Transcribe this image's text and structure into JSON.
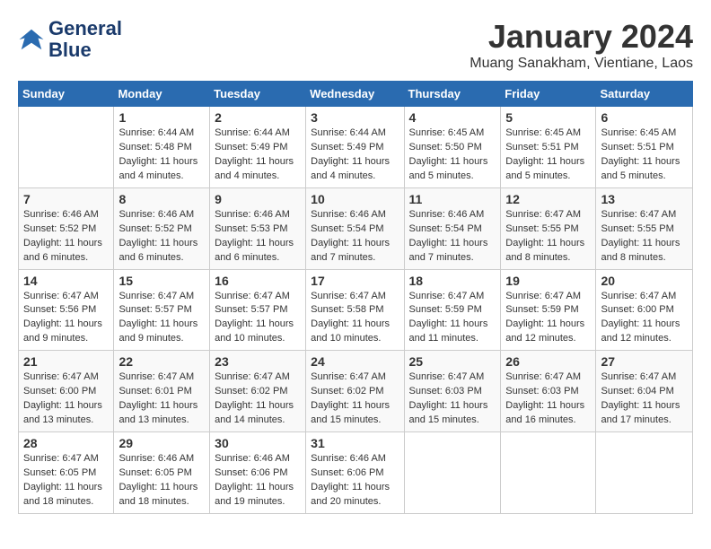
{
  "header": {
    "logo_line1": "General",
    "logo_line2": "Blue",
    "month_title": "January 2024",
    "location": "Muang Sanakham, Vientiane, Laos"
  },
  "days_of_week": [
    "Sunday",
    "Monday",
    "Tuesday",
    "Wednesday",
    "Thursday",
    "Friday",
    "Saturday"
  ],
  "weeks": [
    [
      {
        "day": "",
        "info": ""
      },
      {
        "day": "1",
        "info": "Sunrise: 6:44 AM\nSunset: 5:48 PM\nDaylight: 11 hours\nand 4 minutes."
      },
      {
        "day": "2",
        "info": "Sunrise: 6:44 AM\nSunset: 5:49 PM\nDaylight: 11 hours\nand 4 minutes."
      },
      {
        "day": "3",
        "info": "Sunrise: 6:44 AM\nSunset: 5:49 PM\nDaylight: 11 hours\nand 4 minutes."
      },
      {
        "day": "4",
        "info": "Sunrise: 6:45 AM\nSunset: 5:50 PM\nDaylight: 11 hours\nand 5 minutes."
      },
      {
        "day": "5",
        "info": "Sunrise: 6:45 AM\nSunset: 5:51 PM\nDaylight: 11 hours\nand 5 minutes."
      },
      {
        "day": "6",
        "info": "Sunrise: 6:45 AM\nSunset: 5:51 PM\nDaylight: 11 hours\nand 5 minutes."
      }
    ],
    [
      {
        "day": "7",
        "info": "Sunrise: 6:46 AM\nSunset: 5:52 PM\nDaylight: 11 hours\nand 6 minutes."
      },
      {
        "day": "8",
        "info": "Sunrise: 6:46 AM\nSunset: 5:52 PM\nDaylight: 11 hours\nand 6 minutes."
      },
      {
        "day": "9",
        "info": "Sunrise: 6:46 AM\nSunset: 5:53 PM\nDaylight: 11 hours\nand 6 minutes."
      },
      {
        "day": "10",
        "info": "Sunrise: 6:46 AM\nSunset: 5:54 PM\nDaylight: 11 hours\nand 7 minutes."
      },
      {
        "day": "11",
        "info": "Sunrise: 6:46 AM\nSunset: 5:54 PM\nDaylight: 11 hours\nand 7 minutes."
      },
      {
        "day": "12",
        "info": "Sunrise: 6:47 AM\nSunset: 5:55 PM\nDaylight: 11 hours\nand 8 minutes."
      },
      {
        "day": "13",
        "info": "Sunrise: 6:47 AM\nSunset: 5:55 PM\nDaylight: 11 hours\nand 8 minutes."
      }
    ],
    [
      {
        "day": "14",
        "info": "Sunrise: 6:47 AM\nSunset: 5:56 PM\nDaylight: 11 hours\nand 9 minutes."
      },
      {
        "day": "15",
        "info": "Sunrise: 6:47 AM\nSunset: 5:57 PM\nDaylight: 11 hours\nand 9 minutes."
      },
      {
        "day": "16",
        "info": "Sunrise: 6:47 AM\nSunset: 5:57 PM\nDaylight: 11 hours\nand 10 minutes."
      },
      {
        "day": "17",
        "info": "Sunrise: 6:47 AM\nSunset: 5:58 PM\nDaylight: 11 hours\nand 10 minutes."
      },
      {
        "day": "18",
        "info": "Sunrise: 6:47 AM\nSunset: 5:59 PM\nDaylight: 11 hours\nand 11 minutes."
      },
      {
        "day": "19",
        "info": "Sunrise: 6:47 AM\nSunset: 5:59 PM\nDaylight: 11 hours\nand 12 minutes."
      },
      {
        "day": "20",
        "info": "Sunrise: 6:47 AM\nSunset: 6:00 PM\nDaylight: 11 hours\nand 12 minutes."
      }
    ],
    [
      {
        "day": "21",
        "info": "Sunrise: 6:47 AM\nSunset: 6:00 PM\nDaylight: 11 hours\nand 13 minutes."
      },
      {
        "day": "22",
        "info": "Sunrise: 6:47 AM\nSunset: 6:01 PM\nDaylight: 11 hours\nand 13 minutes."
      },
      {
        "day": "23",
        "info": "Sunrise: 6:47 AM\nSunset: 6:02 PM\nDaylight: 11 hours\nand 14 minutes."
      },
      {
        "day": "24",
        "info": "Sunrise: 6:47 AM\nSunset: 6:02 PM\nDaylight: 11 hours\nand 15 minutes."
      },
      {
        "day": "25",
        "info": "Sunrise: 6:47 AM\nSunset: 6:03 PM\nDaylight: 11 hours\nand 15 minutes."
      },
      {
        "day": "26",
        "info": "Sunrise: 6:47 AM\nSunset: 6:03 PM\nDaylight: 11 hours\nand 16 minutes."
      },
      {
        "day": "27",
        "info": "Sunrise: 6:47 AM\nSunset: 6:04 PM\nDaylight: 11 hours\nand 17 minutes."
      }
    ],
    [
      {
        "day": "28",
        "info": "Sunrise: 6:47 AM\nSunset: 6:05 PM\nDaylight: 11 hours\nand 18 minutes."
      },
      {
        "day": "29",
        "info": "Sunrise: 6:46 AM\nSunset: 6:05 PM\nDaylight: 11 hours\nand 18 minutes."
      },
      {
        "day": "30",
        "info": "Sunrise: 6:46 AM\nSunset: 6:06 PM\nDaylight: 11 hours\nand 19 minutes."
      },
      {
        "day": "31",
        "info": "Sunrise: 6:46 AM\nSunset: 6:06 PM\nDaylight: 11 hours\nand 20 minutes."
      },
      {
        "day": "",
        "info": ""
      },
      {
        "day": "",
        "info": ""
      },
      {
        "day": "",
        "info": ""
      }
    ]
  ]
}
